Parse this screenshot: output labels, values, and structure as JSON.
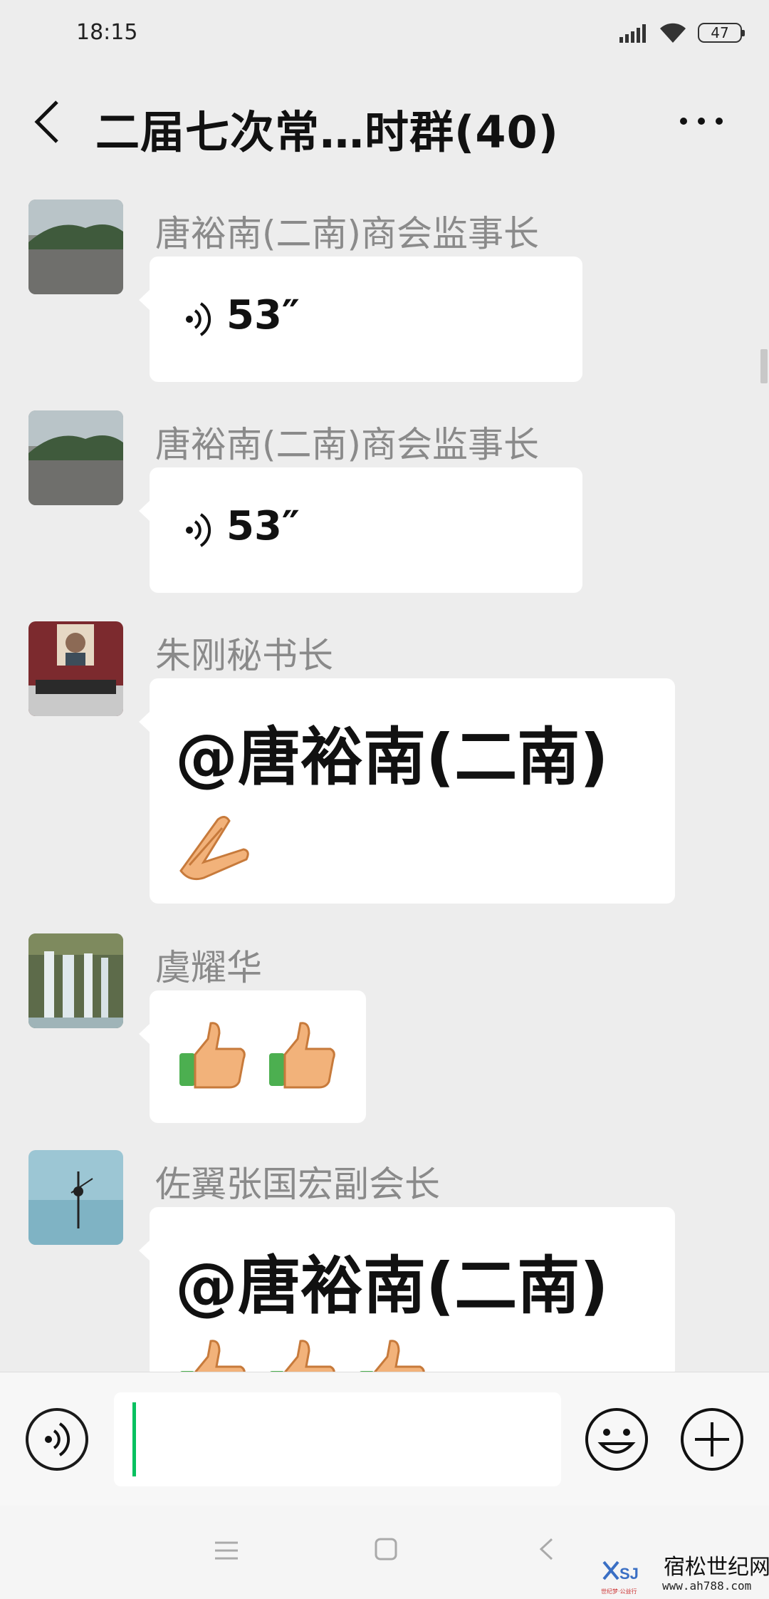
{
  "status_bar": {
    "time": "18:15",
    "battery": "47"
  },
  "header": {
    "title": "二届七次常…时群(40)"
  },
  "messages": [
    {
      "sender": "唐裕南(二南)商会监事长",
      "type": "voice",
      "duration": "53″",
      "avatar_icon": "lake-landscape"
    },
    {
      "sender": "唐裕南(二南)商会监事长",
      "type": "voice",
      "duration": "53″",
      "avatar_icon": "lake-landscape"
    },
    {
      "sender": "朱刚秘书长",
      "type": "text",
      "mention": "@唐裕南(二南)",
      "emojis": [
        "clap-hands"
      ],
      "avatar_icon": "tiananmen-gate"
    },
    {
      "sender": "虞耀华",
      "type": "emoji",
      "emojis": [
        "thumbs-up",
        "thumbs-up"
      ],
      "avatar_icon": "waterfall"
    },
    {
      "sender": "佐翼张国宏副会长",
      "type": "text",
      "mention": "@唐裕南(二南)",
      "emojis": [
        "thumbs-up",
        "thumbs-up",
        "thumbs-up"
      ],
      "avatar_icon": "stilt-fisherman"
    }
  ],
  "input": {
    "value": "",
    "placeholder": ""
  },
  "watermark": {
    "title": "宿松世纪网",
    "url": "www.ah788.com",
    "logo_text": "SJ",
    "logo_caption": "世纪梦·公益行"
  },
  "colors": {
    "background": "#ededed",
    "bubble": "#ffffff",
    "sender": "#8a8a8a",
    "caret": "#07c160"
  }
}
